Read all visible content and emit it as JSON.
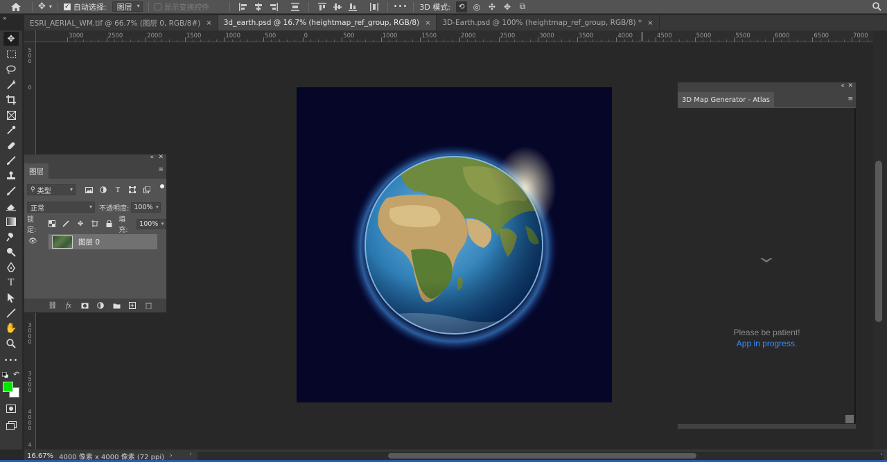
{
  "options_bar": {
    "auto_select_label": "自动选择:",
    "auto_select_target": "图层",
    "show_transform_label": "显示变换控件",
    "more_label": "•••",
    "mode_3d_label": "3D 模式:"
  },
  "tabs": [
    {
      "label": "ESRI_AERIAL_WM.tif @ 66.7% (图层 0, RGB/8#)",
      "active": false
    },
    {
      "label": "3d_earth.psd @ 16.7% (heightmap_ref_group, RGB/8)",
      "active": true
    },
    {
      "label": "3D-Earth.psd @ 100% (heightmap_ref_group, RGB/8) *",
      "active": false
    }
  ],
  "ruler_labels": [
    "3000",
    "2500",
    "2000",
    "1500",
    "1000",
    "500",
    "0",
    "500",
    "1000",
    "1500",
    "2000",
    "2500",
    "3000",
    "3500",
    "4000",
    "4500",
    "5000",
    "5500",
    "6000",
    "6500",
    "7000"
  ],
  "vruler_labels": [
    "500",
    "0",
    "3000",
    "3500",
    "4000",
    "4"
  ],
  "layers_panel": {
    "title": "图层",
    "filter_kind": "类型",
    "blend_mode": "正常",
    "opacity_label": "不透明度:",
    "opacity_value": "100%",
    "lock_label": "锁定:",
    "fill_label": "填充:",
    "fill_value": "100%",
    "layer_name": "图层 0"
  },
  "plugin_panel": {
    "title": "3D Map Generator - Atlas",
    "message_line1": "Please be patient!",
    "message_line2": "App in progress."
  },
  "status_bar": {
    "zoom": "16.67%",
    "doc_info": "4000 像素 x 4000 像素 (72 ppi)"
  },
  "colors": {
    "foreground": "#00e600",
    "background": "#ffffff",
    "accent_link": "#3d8bff",
    "status_text": "#8a8a8a"
  }
}
